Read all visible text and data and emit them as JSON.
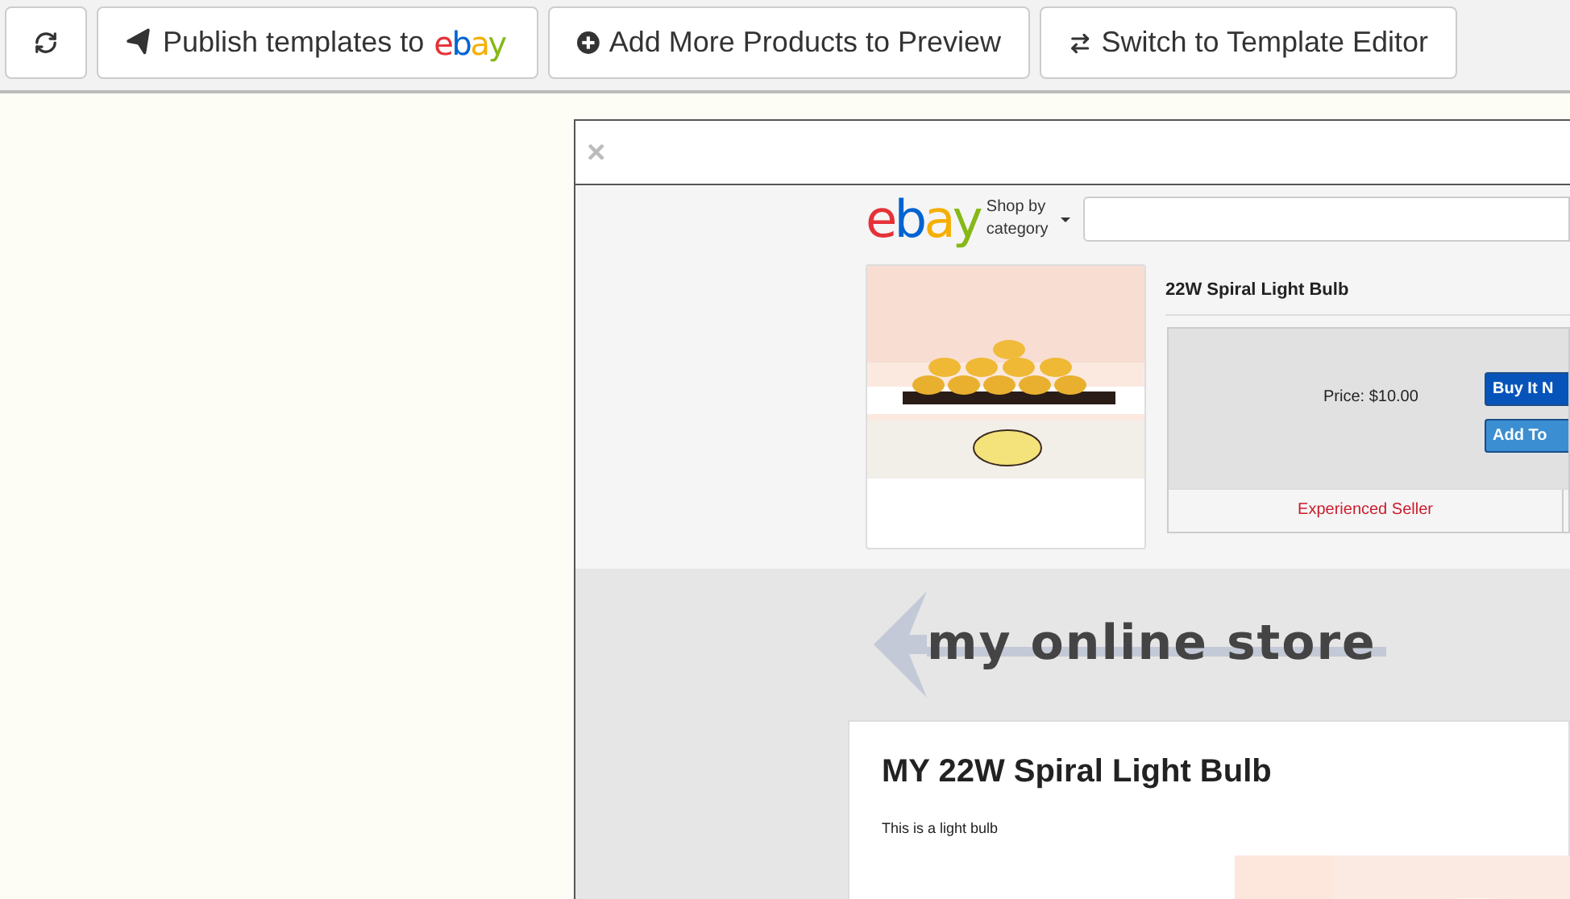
{
  "toolbar": {
    "buttons": [
      {
        "kind": "refresh"
      },
      {
        "kind": "publish",
        "label": "Publish templates to",
        "logo": "ebay"
      },
      {
        "kind": "add",
        "label": "Add More Products to Preview"
      },
      {
        "kind": "switch",
        "label": "Switch to Template Editor"
      }
    ]
  },
  "preview": {
    "close": "×",
    "listing": {
      "logo": "ebay",
      "shop_by": "Shop by category",
      "title": "22W Spiral Light Bulb",
      "price": "Price: $10.00",
      "buttons": [
        {
          "kind": "buy",
          "label": "Buy It N"
        },
        {
          "kind": "cart",
          "label": "Add To"
        }
      ],
      "seller": "Experienced Seller"
    },
    "store": {
      "banner": "my online store",
      "heading": "MY 22W Spiral Light Bulb",
      "description": "This is a light bulb"
    }
  }
}
